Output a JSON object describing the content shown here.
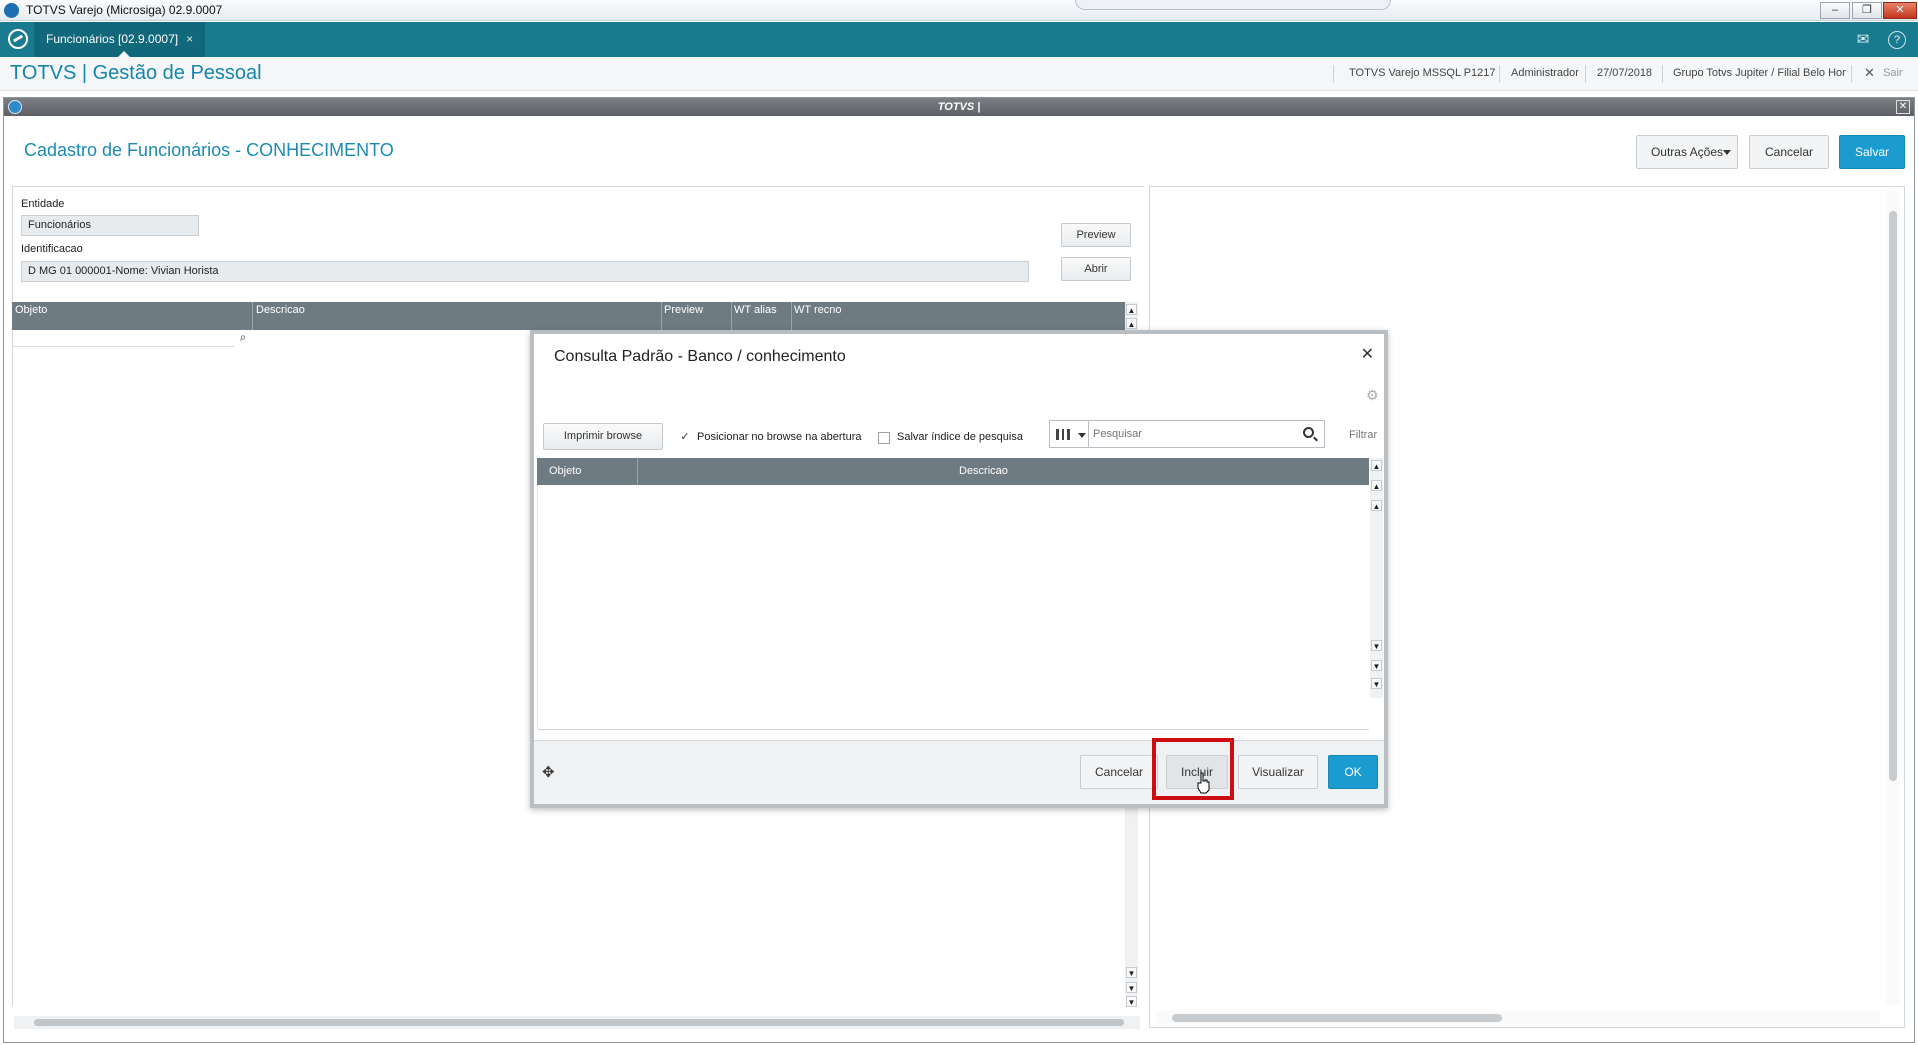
{
  "window": {
    "title": "TOTVS Varejo (Microsiga) 02.9.0007",
    "ctrl_min": "‒",
    "ctrl_max": "❐",
    "ctrl_close": "✕"
  },
  "tabbar": {
    "tab_label": "Funcionários [02.9.0007]",
    "tab_close": "×",
    "mail_glyph": "✉",
    "help_glyph": "?"
  },
  "header": {
    "brand": "TOTVS | Gestão de Pessoal",
    "env": "TOTVS Varejo MSSQL P1217",
    "user": "Administrador",
    "date": "27/07/2018",
    "company": "Grupo Totvs Jupiter / Filial Belo Hor",
    "exit_glyph": "✕",
    "exit": "Sair"
  },
  "form": {
    "titlebar": "TOTVS |",
    "close_glyph": "✕",
    "title": "Cadastro de Funcionários - CONHECIMENTO",
    "actions": {
      "outras": "Outras Ações",
      "cancel": "Cancelar",
      "save": "Salvar"
    },
    "entidade_label": "Entidade",
    "entidade_value": "Funcionários",
    "ident_label": "Identificacao",
    "ident_value": "D MG 01 000001-Nome: Vivian Horista",
    "preview_btn": "Preview",
    "abrir_btn": "Abrir",
    "grid_cols": [
      "Objeto",
      "Descricao",
      "Preview",
      "WT alias",
      "WT recno"
    ]
  },
  "modal": {
    "title": "Consulta Padrão - Banco / conhecimento",
    "close_glyph": "✕",
    "print_btn": "Imprimir browse",
    "chk_position": {
      "label": "Posicionar no browse na abertura",
      "checked": true,
      "mark": "✓"
    },
    "chk_save_index": {
      "label": "Salvar índice de pesquisa",
      "checked": false
    },
    "search_placeholder": "Pesquisar",
    "filter_label": "Filtrar",
    "columns": [
      "Objeto",
      "Descricao"
    ],
    "footer": {
      "move_glyph": "✥",
      "cancel": "Cancelar",
      "incluir": "Incluir",
      "visualizar": "Visualizar",
      "ok": "OK"
    }
  },
  "colors": {
    "accent": "#1a9cd0",
    "tabbar": "#197b90",
    "highlight": "#cc0e13"
  }
}
